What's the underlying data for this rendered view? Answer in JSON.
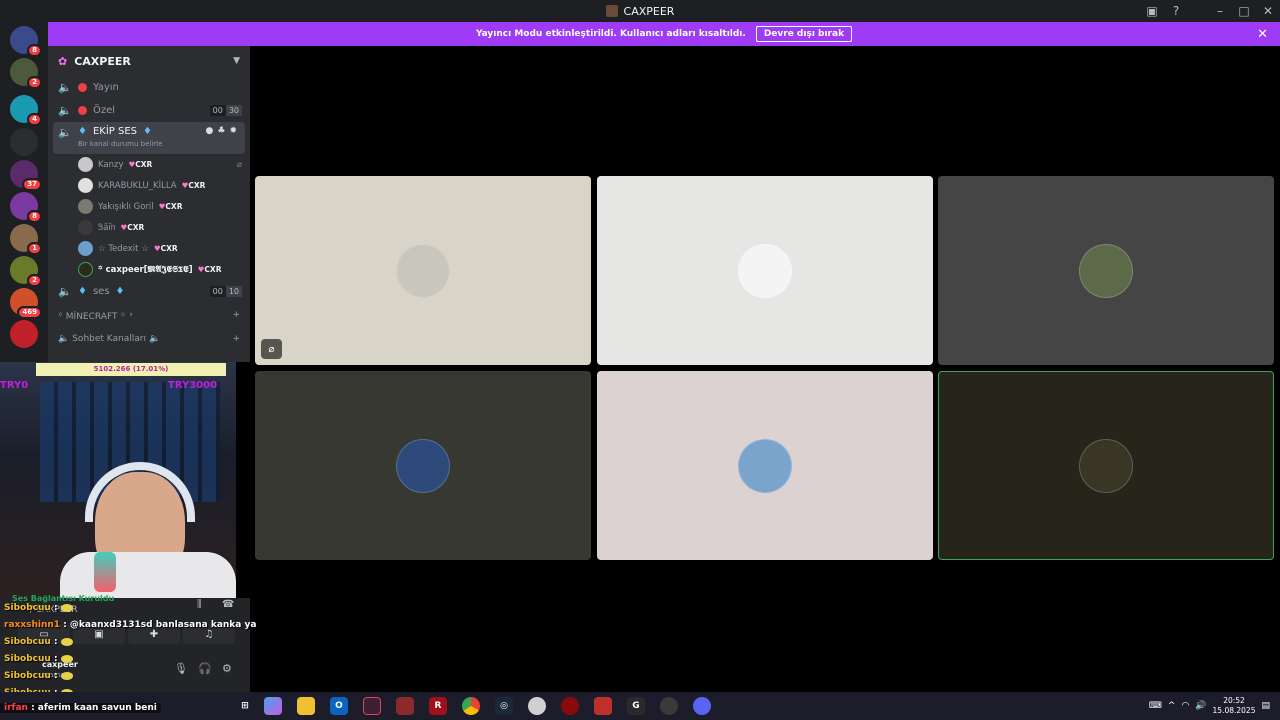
{
  "window": {
    "title": "CAXPEER"
  },
  "banner": {
    "message": "Yayıncı Modu etkinleştirildi. Kullanıcı adları kısaltıldı.",
    "button": "Devre dışı bırak"
  },
  "guild_badges": [
    "8",
    "2",
    "4",
    "37",
    "8",
    "1",
    "2",
    "469"
  ],
  "server": {
    "name": "CAXPEER",
    "channels": [
      {
        "name": "Yayın"
      },
      {
        "name": "Özel",
        "counts": [
          "00",
          "30"
        ]
      }
    ],
    "active_channel": {
      "name": "EKİP SES",
      "status": "Bir kanal durumu belirle"
    },
    "members": [
      {
        "name": "Kanzy",
        "tag": "CXR"
      },
      {
        "name": "KARABUKLU_KİLLA",
        "tag": "CXR"
      },
      {
        "name": "Yakışıklı Goril",
        "tag": "CXR"
      },
      {
        "name": "Ꮥâïᥒ",
        "tag": "CXR"
      },
      {
        "name": "☆ Tedexit ☆",
        "tag": "CXR"
      },
      {
        "name": "꙳ caxpeer[𝕸𝕬𝕵𝕰𝕾𝕿𝕰]",
        "tag": "CXR"
      }
    ],
    "ses_channel": {
      "name": "ses",
      "counts": [
        "00",
        "10"
      ]
    },
    "category_minecraft": "꙳ MİNECRAFT ꙳",
    "category_sohbet": "Sohbet Kanalları"
  },
  "stream_overlay": {
    "ticker": "5102.266 (17.01%)",
    "left": "TRY0",
    "right": "TRY3000"
  },
  "voice": {
    "status": "Ses Bağlantısı Kuruldu",
    "channel": "/ CAXPEER"
  },
  "user": {
    "name": "caxpeer",
    "status": "aramada"
  },
  "chat": [
    {
      "user": "Sibobcuu",
      "text": ":"
    },
    {
      "user": "raxxshinn1",
      "text": ": @kaanxd3131sd banlasana kanka ya"
    },
    {
      "user": "Sibobcuu",
      "text": ":"
    },
    {
      "user": "Sibobcuu",
      "text": ":"
    },
    {
      "user": "Sibobcuu",
      "text": ":"
    },
    {
      "user": "Sibobcuu",
      "text": ":"
    }
  ],
  "last_chat": {
    "user": "irfan",
    "text": ": aferim kaan savun beni"
  },
  "tiles": [
    {
      "bg": "#d8d5c8",
      "avatar": "#c9c6bd",
      "muted": true
    },
    {
      "bg": "#e6e6e4",
      "avatar": "#f4f4f4"
    },
    {
      "bg": "#454545",
      "avatar": "#5d6a4a"
    },
    {
      "bg": "#363831",
      "avatar": "#2d4a7a"
    },
    {
      "bg": "#dcd2d2",
      "avatar": "#7ba4cc"
    },
    {
      "bg": "#26251a",
      "avatar": "#3a3626",
      "speaking": true
    }
  ],
  "clock": {
    "time": "20:52",
    "date": "15.08.2025"
  }
}
